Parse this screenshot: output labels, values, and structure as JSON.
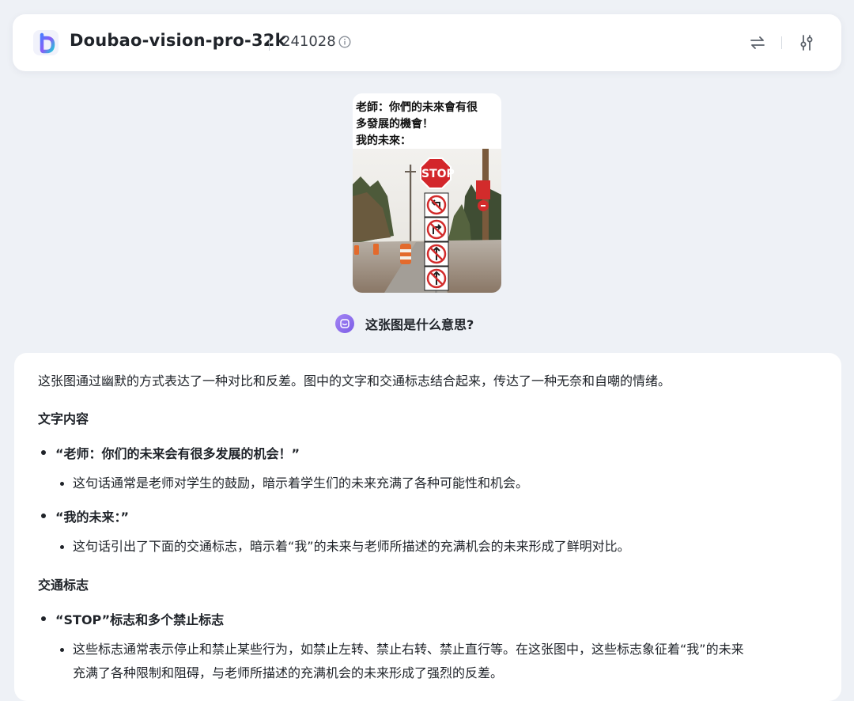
{
  "header": {
    "model_name": "Doubao-vision-pro-32k",
    "version": "241028",
    "icons": [
      "doubao-logo-icon",
      "info-icon",
      "swap-icon",
      "settings-sliders-icon"
    ]
  },
  "image": {
    "caption_lines": [
      "老師：你們的未來會有很",
      "多發展的機會！",
      "我的未來："
    ],
    "sign_text": "STOP"
  },
  "question": {
    "text": "这张图是什么意思?"
  },
  "answer": {
    "intro": "这张图通过幽默的方式表达了一种对比和反差。图中的文字和交通标志结合起来，传达了一种无奈和自嘲的情绪。",
    "section1_title": "文字内容",
    "item1_title": "“老师：你们的未来会有很多发展的机会！”",
    "item1_desc": "这句话通常是老师对学生的鼓励，暗示着学生们的未来充满了各种可能性和机会。",
    "item2_title": "“我的未来：”",
    "item2_desc": "这句话引出了下面的交通标志，暗示着“我”的未来与老师所描述的充满机会的未来形成了鲜明对比。",
    "section2_title": "交通标志",
    "item3_title": "“STOP”标志和多个禁止标志",
    "item3_desc_line1": "这些标志通常表示停止和禁止某些行为，如禁止左转、禁止右转、禁止直行等。在这张图中，这些标志象征着“我”的未来",
    "item3_desc_line2": "充满了各种限制和阻碍，与老师所描述的充满机会的未来形成了强烈的反差。"
  },
  "colors": {
    "background": "#eef1f6",
    "card": "#ffffff",
    "text": "#1f2329",
    "avatar_purple": "#8b6cf0"
  }
}
